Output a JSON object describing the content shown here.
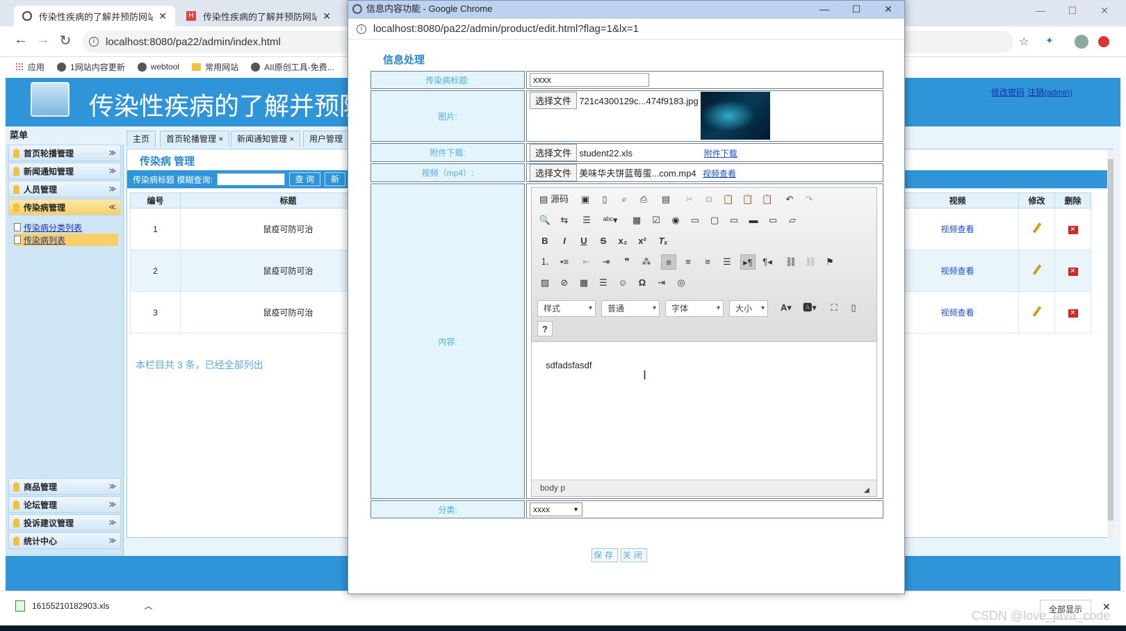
{
  "browser": {
    "tabs": [
      {
        "title": "传染性疾病的了解并预防网站"
      },
      {
        "title": "传染性疾病的了解并预防网站"
      }
    ],
    "url": "localhost:8080/pa22/admin/index.html",
    "bookmarks": [
      "应用",
      "1网站内容更新",
      "webtool",
      "常用网站",
      "AII原创工具-免费..."
    ]
  },
  "site": {
    "title": "传染性疾病的了解并预防",
    "links": [
      "修改密码",
      "注销(admin)"
    ]
  },
  "menu": {
    "header": "菜单",
    "items": [
      {
        "label": "首页轮播管理"
      },
      {
        "label": "新闻通知管理"
      },
      {
        "label": "人员管理"
      },
      {
        "label": "传染病管理"
      }
    ],
    "subitems": [
      {
        "label": "传染病分类列表"
      },
      {
        "label": "传染病列表"
      }
    ],
    "bottom_items": [
      {
        "label": "商品管理"
      },
      {
        "label": "论坛管理"
      },
      {
        "label": "投诉建议管理"
      },
      {
        "label": "统计中心"
      }
    ]
  },
  "content": {
    "tabs": [
      "主页",
      "首页轮播管理 ×",
      "新闻通知管理 ×",
      "用户管理"
    ],
    "panel_title": "传染病 管理",
    "search_label": "传染病标题 模糊查询:",
    "search_button": "查 询",
    "new_button": "新",
    "columns": [
      "编号",
      "标题"
    ],
    "right_columns": [
      "视频",
      "修改",
      "删除"
    ],
    "rows": [
      {
        "id": "1",
        "title": "鼠疫可防可治",
        "video": "视频查看"
      },
      {
        "id": "2",
        "title": "鼠疫可防可治",
        "video": "视频查看"
      },
      {
        "id": "3",
        "title": "鼠疫可防可治",
        "video": "视频查看"
      }
    ],
    "footnote": "本栏目共 3 条，已经全部列出"
  },
  "downloads": {
    "filename": "16155210182903.xls",
    "show_all": "全部显示"
  },
  "watermark": "CSDN @love_java_code",
  "popup": {
    "window_title": "信息内容功能 - Google Chrome",
    "url": "localhost:8080/pa22/admin/product/edit.html?flag=1&lx=1",
    "section_title": "信息处理",
    "fields": {
      "title_label": "传染病标题:",
      "title_value": "xxxx",
      "image_label": "图片:",
      "image_button": "选择文件",
      "image_file": "721c4300129c...474f9183.jpg",
      "attachment_label": "附件下载:",
      "attachment_button": "选择文件",
      "attachment_file": "student22.xls",
      "attachment_link": "附件下载",
      "video_label": "视频（mp4）:",
      "video_button": "选择文件",
      "video_file": "美味华夫饼蓝莓蛋...com.mp4",
      "video_link": "视频查看",
      "content_label": "内容:",
      "category_label": "分类:",
      "category_value": "xxxx"
    },
    "editor": {
      "source_label": "源码",
      "combo_style": "样式",
      "combo_format": "普通",
      "combo_font": "字体",
      "combo_size": "大小",
      "text": "sdfadsfasdf",
      "status_path": "body  p"
    },
    "save_button": "保存",
    "close_button": "关闭"
  }
}
